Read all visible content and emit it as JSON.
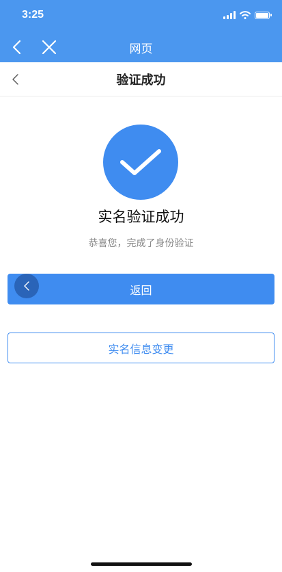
{
  "status_bar": {
    "time": "3:25"
  },
  "nav_bar": {
    "title": "网页",
    "back_icon": "chevron-left-icon",
    "close_icon": "close-icon"
  },
  "page_header": {
    "title": "验证成功",
    "back_icon": "chevron-left-icon"
  },
  "result": {
    "icon": "checkmark-icon",
    "title": "实名验证成功",
    "subtitle": "恭喜您，完成了身份验证"
  },
  "buttons": {
    "back_label": "返回",
    "change_label": "实名信息变更"
  },
  "colors": {
    "nav_blue": "#4b97ef",
    "primary_blue": "#3f8cf0",
    "float_button": "#2a64b8"
  }
}
